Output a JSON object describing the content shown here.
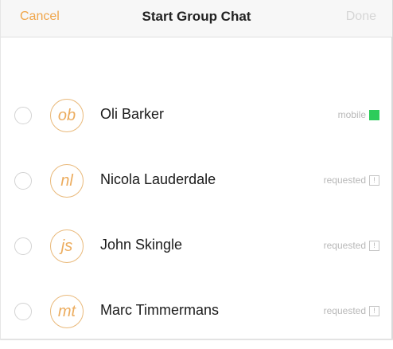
{
  "navbar": {
    "cancel_label": "Cancel",
    "title": "Start Group Chat",
    "done_label": "Done"
  },
  "contacts": [
    {
      "initials": "ob",
      "name": "Oli Barker",
      "status": "mobile",
      "indicator": "green-square"
    },
    {
      "initials": "nl",
      "name": "Nicola Lauderdale",
      "status": "requested",
      "indicator": "outlined-square-icon"
    },
    {
      "initials": "js",
      "name": "John Skingle",
      "status": "requested",
      "indicator": "outlined-square-icon"
    },
    {
      "initials": "mt",
      "name": "Marc Timmermans",
      "status": "requested",
      "indicator": "outlined-square-icon"
    }
  ],
  "colors": {
    "accent": "#f0a64a",
    "online": "#2ecc5b",
    "disabled": "#d6d6d6"
  }
}
